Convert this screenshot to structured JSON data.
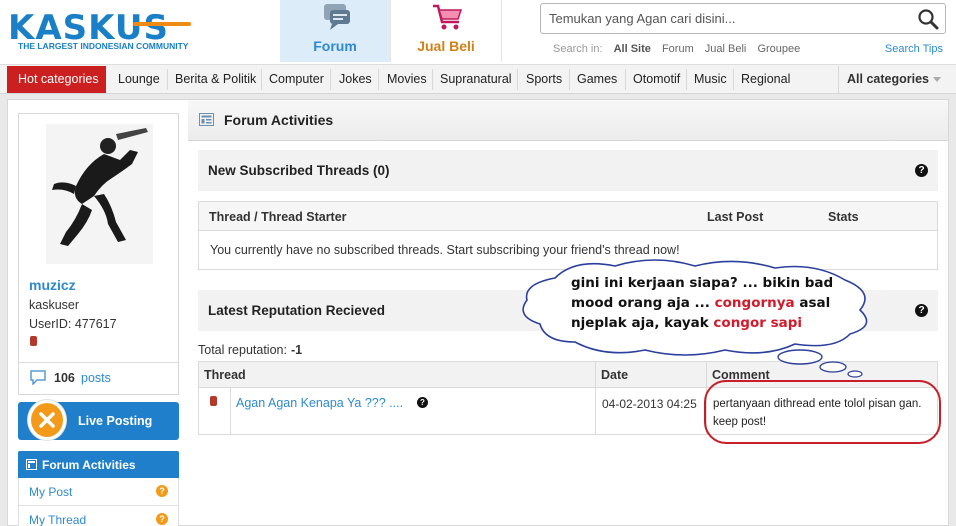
{
  "header": {
    "logo_text": "KASKUS",
    "logo_tagline": "THE LARGEST INDONESIAN COMMUNITY",
    "nav": [
      {
        "label": "Forum",
        "active": true
      },
      {
        "label": "Jual Beli",
        "active": false
      }
    ],
    "search": {
      "placeholder": "Temukan yang Agan cari disini...",
      "search_in_label": "Search in:",
      "options": [
        "All Site",
        "Forum",
        "Jual Beli",
        "Groupee"
      ],
      "tips": "Search Tips"
    }
  },
  "categories": {
    "hot": "Hot categories",
    "items": [
      "Lounge",
      "Berita & Politik",
      "Computer",
      "Jokes",
      "Movies",
      "Supranatural",
      "Sports",
      "Games",
      "Otomotif",
      "Music",
      "Regional"
    ],
    "all": "All categories"
  },
  "sidebar": {
    "username": "muzicz",
    "user_title": "kaskuser",
    "user_id": "UserID: 477617",
    "post_count": "106",
    "posts_label": "posts",
    "live_posting": "Live Posting",
    "forum_activities": "Forum Activities",
    "links": [
      "My Post",
      "My Thread"
    ]
  },
  "content": {
    "title": "Forum Activities",
    "subscribed": {
      "title": "New Subscribed Threads (0)",
      "columns": [
        "Thread / Thread Starter",
        "Last Post",
        "Stats"
      ],
      "empty_message": "You currently have no subscribed threads. Start subscribing your friend's thread now!"
    },
    "reputation": {
      "title": "Latest Reputation Recieved",
      "total_label": "Total reputation:",
      "total_value": "-1",
      "columns": [
        "Thread",
        "Date",
        "Comment"
      ],
      "rows": [
        {
          "thread": "Agan Agan Kenapa Ya ??? ....",
          "date": "04-02-2013 04:25",
          "comment": "pertanyaan dithread ente tolol pisan gan. keep post!"
        }
      ]
    }
  },
  "annotation": {
    "line1": "gini ini kerjaan siapa? ... bikin bad",
    "line2_a": "mood orang aja ... ",
    "line2_red": "congornya",
    "line2_b": " asal",
    "line3_a": "njeplak aja, kayak ",
    "line3_red": "congor sapi",
    "highlight_color": "#d11a2a"
  },
  "colors": {
    "brand_blue": "#1a7fc6",
    "hot_red": "#cc1f1f",
    "link_blue": "#2e8ad0",
    "accent_orange": "#f39a1a"
  }
}
